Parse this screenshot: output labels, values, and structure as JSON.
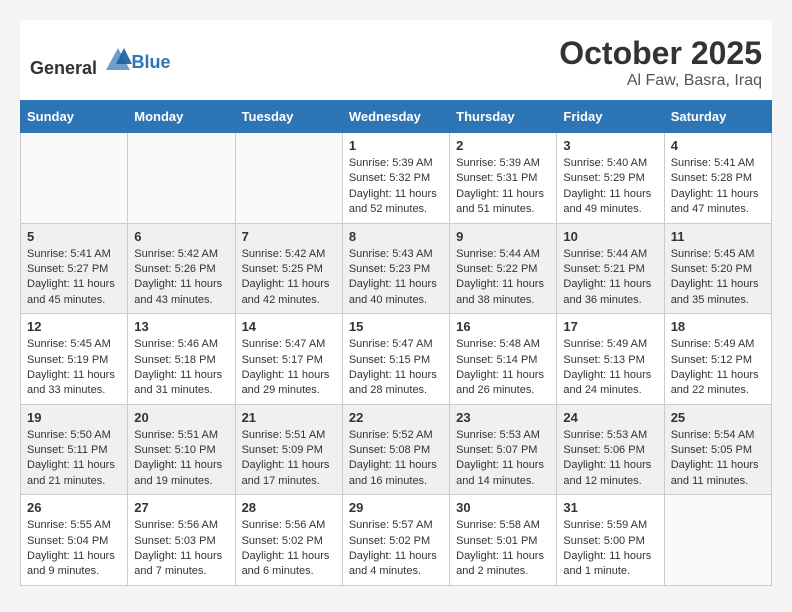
{
  "header": {
    "logo_general": "General",
    "logo_blue": "Blue",
    "month": "October 2025",
    "location": "Al Faw, Basra, Iraq"
  },
  "days_of_week": [
    "Sunday",
    "Monday",
    "Tuesday",
    "Wednesday",
    "Thursday",
    "Friday",
    "Saturday"
  ],
  "weeks": [
    {
      "shaded": false,
      "cells": [
        {
          "day": "",
          "content": ""
        },
        {
          "day": "",
          "content": ""
        },
        {
          "day": "",
          "content": ""
        },
        {
          "day": "1",
          "content": "Sunrise: 5:39 AM\nSunset: 5:32 PM\nDaylight: 11 hours\nand 52 minutes."
        },
        {
          "day": "2",
          "content": "Sunrise: 5:39 AM\nSunset: 5:31 PM\nDaylight: 11 hours\nand 51 minutes."
        },
        {
          "day": "3",
          "content": "Sunrise: 5:40 AM\nSunset: 5:29 PM\nDaylight: 11 hours\nand 49 minutes."
        },
        {
          "day": "4",
          "content": "Sunrise: 5:41 AM\nSunset: 5:28 PM\nDaylight: 11 hours\nand 47 minutes."
        }
      ]
    },
    {
      "shaded": true,
      "cells": [
        {
          "day": "5",
          "content": "Sunrise: 5:41 AM\nSunset: 5:27 PM\nDaylight: 11 hours\nand 45 minutes."
        },
        {
          "day": "6",
          "content": "Sunrise: 5:42 AM\nSunset: 5:26 PM\nDaylight: 11 hours\nand 43 minutes."
        },
        {
          "day": "7",
          "content": "Sunrise: 5:42 AM\nSunset: 5:25 PM\nDaylight: 11 hours\nand 42 minutes."
        },
        {
          "day": "8",
          "content": "Sunrise: 5:43 AM\nSunset: 5:23 PM\nDaylight: 11 hours\nand 40 minutes."
        },
        {
          "day": "9",
          "content": "Sunrise: 5:44 AM\nSunset: 5:22 PM\nDaylight: 11 hours\nand 38 minutes."
        },
        {
          "day": "10",
          "content": "Sunrise: 5:44 AM\nSunset: 5:21 PM\nDaylight: 11 hours\nand 36 minutes."
        },
        {
          "day": "11",
          "content": "Sunrise: 5:45 AM\nSunset: 5:20 PM\nDaylight: 11 hours\nand 35 minutes."
        }
      ]
    },
    {
      "shaded": false,
      "cells": [
        {
          "day": "12",
          "content": "Sunrise: 5:45 AM\nSunset: 5:19 PM\nDaylight: 11 hours\nand 33 minutes."
        },
        {
          "day": "13",
          "content": "Sunrise: 5:46 AM\nSunset: 5:18 PM\nDaylight: 11 hours\nand 31 minutes."
        },
        {
          "day": "14",
          "content": "Sunrise: 5:47 AM\nSunset: 5:17 PM\nDaylight: 11 hours\nand 29 minutes."
        },
        {
          "day": "15",
          "content": "Sunrise: 5:47 AM\nSunset: 5:15 PM\nDaylight: 11 hours\nand 28 minutes."
        },
        {
          "day": "16",
          "content": "Sunrise: 5:48 AM\nSunset: 5:14 PM\nDaylight: 11 hours\nand 26 minutes."
        },
        {
          "day": "17",
          "content": "Sunrise: 5:49 AM\nSunset: 5:13 PM\nDaylight: 11 hours\nand 24 minutes."
        },
        {
          "day": "18",
          "content": "Sunrise: 5:49 AM\nSunset: 5:12 PM\nDaylight: 11 hours\nand 22 minutes."
        }
      ]
    },
    {
      "shaded": true,
      "cells": [
        {
          "day": "19",
          "content": "Sunrise: 5:50 AM\nSunset: 5:11 PM\nDaylight: 11 hours\nand 21 minutes."
        },
        {
          "day": "20",
          "content": "Sunrise: 5:51 AM\nSunset: 5:10 PM\nDaylight: 11 hours\nand 19 minutes."
        },
        {
          "day": "21",
          "content": "Sunrise: 5:51 AM\nSunset: 5:09 PM\nDaylight: 11 hours\nand 17 minutes."
        },
        {
          "day": "22",
          "content": "Sunrise: 5:52 AM\nSunset: 5:08 PM\nDaylight: 11 hours\nand 16 minutes."
        },
        {
          "day": "23",
          "content": "Sunrise: 5:53 AM\nSunset: 5:07 PM\nDaylight: 11 hours\nand 14 minutes."
        },
        {
          "day": "24",
          "content": "Sunrise: 5:53 AM\nSunset: 5:06 PM\nDaylight: 11 hours\nand 12 minutes."
        },
        {
          "day": "25",
          "content": "Sunrise: 5:54 AM\nSunset: 5:05 PM\nDaylight: 11 hours\nand 11 minutes."
        }
      ]
    },
    {
      "shaded": false,
      "cells": [
        {
          "day": "26",
          "content": "Sunrise: 5:55 AM\nSunset: 5:04 PM\nDaylight: 11 hours\nand 9 minutes."
        },
        {
          "day": "27",
          "content": "Sunrise: 5:56 AM\nSunset: 5:03 PM\nDaylight: 11 hours\nand 7 minutes."
        },
        {
          "day": "28",
          "content": "Sunrise: 5:56 AM\nSunset: 5:02 PM\nDaylight: 11 hours\nand 6 minutes."
        },
        {
          "day": "29",
          "content": "Sunrise: 5:57 AM\nSunset: 5:02 PM\nDaylight: 11 hours\nand 4 minutes."
        },
        {
          "day": "30",
          "content": "Sunrise: 5:58 AM\nSunset: 5:01 PM\nDaylight: 11 hours\nand 2 minutes."
        },
        {
          "day": "31",
          "content": "Sunrise: 5:59 AM\nSunset: 5:00 PM\nDaylight: 11 hours\nand 1 minute."
        },
        {
          "day": "",
          "content": ""
        }
      ]
    }
  ]
}
